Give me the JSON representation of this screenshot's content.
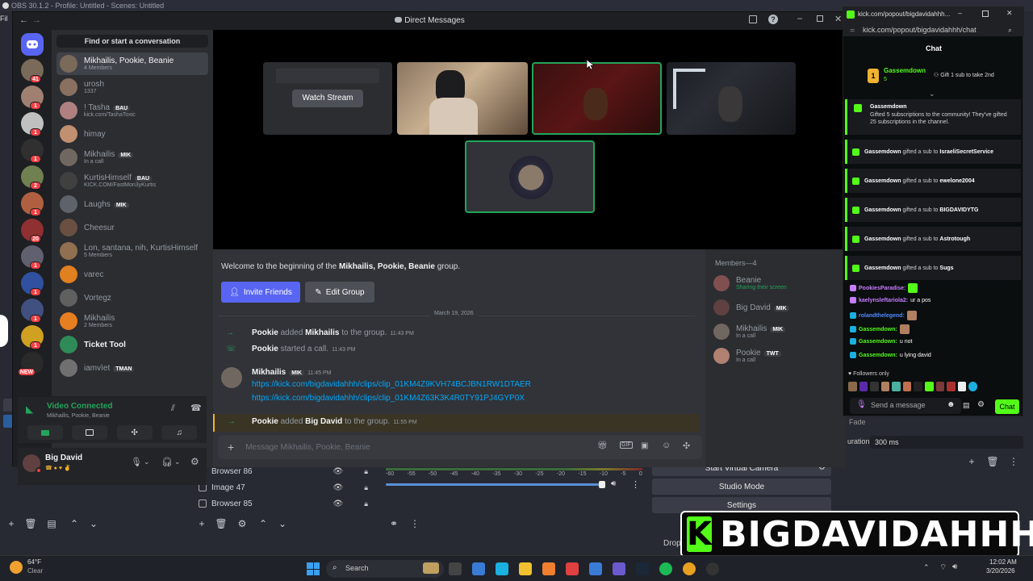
{
  "obs": {
    "window_title": "OBS 30.1.2 - Profile: Untitled - Scenes: Untitled",
    "menu_first": "Fil",
    "sources": [
      {
        "name": "Browser 86",
        "icon": "browser-icon"
      },
      {
        "name": "Image 47",
        "icon": "image-icon"
      },
      {
        "name": "Browser 85",
        "icon": "browser-icon"
      }
    ],
    "audio_ticks": [
      "-60",
      "-55",
      "-50",
      "-45",
      "-40",
      "-35",
      "-30",
      "-25",
      "-20",
      "-15",
      "-10",
      "-5",
      "0"
    ],
    "controls": [
      "Start Virtual Camera",
      "Studio Mode",
      "Settings"
    ],
    "transition_label": "Fade",
    "duration_label": "uration",
    "duration_value": "300 ms",
    "drop_label": "Drop"
  },
  "discord": {
    "window_title": "Direct Messages",
    "search_placeholder": "Find or start a conversation",
    "guild_badges": [
      "41",
      "1",
      "1",
      "1",
      "2",
      "1",
      "20",
      "1",
      "1",
      "1",
      "1",
      "NEW"
    ],
    "dms": [
      {
        "name": "Mikhailis, Pookie, Beanie",
        "sub": "4 Members",
        "tag": "",
        "color": "#7a6a5a"
      },
      {
        "name": "urosh",
        "sub": "1337",
        "tag": "",
        "color": "#8a7060"
      },
      {
        "name": "! Tasha",
        "sub": "kick.com/TashaToxic",
        "tag": "BAU",
        "color": "#b08080"
      },
      {
        "name": "himay",
        "sub": "",
        "tag": "",
        "color": "#c09070"
      },
      {
        "name": "Mikhailis",
        "sub": "In a call",
        "tag": "MIK",
        "color": "#706860"
      },
      {
        "name": "KurtisHimself",
        "sub": "KICK.COM/FastMon3yKurtis",
        "tag": "BAU",
        "color": "#404040"
      },
      {
        "name": "Laughs",
        "sub": "",
        "tag": "MIK",
        "color": "#5d626b"
      },
      {
        "name": "Cheesur",
        "sub": "",
        "tag": "",
        "color": "#6a5040"
      },
      {
        "name": "Lon, santana, nih, KurtisHimself",
        "sub": "5 Members",
        "tag": "",
        "color": "#907050"
      },
      {
        "name": "varec",
        "sub": "",
        "tag": "",
        "color": "#e08020"
      },
      {
        "name": "Vortegz",
        "sub": "",
        "tag": "",
        "color": "#606060"
      },
      {
        "name": "Mikhailis",
        "sub": "2 Members",
        "tag": "",
        "color": "#e67e22"
      },
      {
        "name": "Ticket Tool",
        "sub": "",
        "tag": "",
        "color": "#2e8b57"
      },
      {
        "name": "iamvìet",
        "sub": "",
        "tag": "TMAN",
        "color": "#707070"
      }
    ],
    "voice": {
      "status": "Video Connected",
      "channel": "Mikhailis, Pookie, Beanie"
    },
    "user": {
      "name": "Big David"
    },
    "call": {
      "watch_stream": "Watch Stream"
    },
    "welcome": {
      "prefix": "Welcome to the beginning of the ",
      "group": "Mikhailis, Pookie, Beanie",
      "suffix": " group."
    },
    "invite_button": "Invite Friends",
    "edit_button": "Edit Group",
    "date_divider": "March 19, 2026",
    "messages": [
      {
        "actor": "Pookie",
        "verb": "added",
        "target": "Mikhailis",
        "rest": "to the group.",
        "time": "11:43 PM"
      },
      {
        "actor": "Pookie",
        "verb": "started a call.",
        "target": "",
        "rest": "",
        "time": "11:43 PM"
      },
      {
        "actor": "Pookie",
        "verb": "added",
        "target": "Big David",
        "rest": "to the group.",
        "time": "11:55 PM"
      }
    ],
    "post": {
      "author": "Mikhailis",
      "tag": "MIK",
      "time": "11:45 PM",
      "links": [
        "https://kick.com/bigdavidahhh/clips/clip_01KM4Z9KVH74BCJBN1RW1DTAER",
        "https://kick.com/bigdavidahhh/clips/clip_01KM4Z63K3K4R0TY91PJ4GYP0X"
      ]
    },
    "members_header": "Members—4",
    "members": [
      {
        "name": "Beanie",
        "sub": "Sharing their screen",
        "tag": "",
        "color": "#805050"
      },
      {
        "name": "Big David",
        "sub": "",
        "tag": "MIK",
        "color": "#604040"
      },
      {
        "name": "Mikhailis",
        "sub": "In a call",
        "tag": "MIK",
        "color": "#706860"
      },
      {
        "name": "Pookie",
        "sub": "In a call",
        "tag": "TWT",
        "color": "#b08070"
      }
    ],
    "composer_placeholder": "Message Mikhailis, Pookie, Beanie"
  },
  "kick": {
    "tab_title": "kick.com/popout/bigdavidahhh...",
    "url": "kick.com/popout/bigdavidahhh/chat",
    "chat_header": "Chat",
    "pinned": {
      "user": "Gassemdown",
      "count": "5",
      "action": "Gift 1 sub to take 2nd"
    },
    "gift_main": {
      "user": "Gassemdown",
      "text": "Gifted 5 subscriptions to the community! They've gifted 25 subscriptions in the channel."
    },
    "gifts": [
      {
        "user": "Gassemdown",
        "text": "gifted a sub to",
        "target": "IsraeliSecretService"
      },
      {
        "user": "Gassemdown",
        "text": "gifted a sub to",
        "target": "ewelone2004"
      },
      {
        "user": "Gassemdown",
        "text": "gifted a sub to",
        "target": "BIGDAVIDYTG"
      },
      {
        "user": "Gassemdown",
        "text": "gifted a sub to",
        "target": "Astrotough"
      },
      {
        "user": "Gassemdown",
        "text": "gifted a sub to",
        "target": "Sugs"
      }
    ],
    "chat_lines": [
      {
        "user": "PookiesParadise:",
        "text": "",
        "color": "#c77dff"
      },
      {
        "user": "kaelynsleftariola2:",
        "text": "ur a pos",
        "color": "#c77dff"
      },
      {
        "user": "rolandthelegend:",
        "text": "",
        "color": "#4f8bff"
      },
      {
        "user": "Gassemdown:",
        "text": "",
        "color": "#53fc18"
      },
      {
        "user": "Gassemdown:",
        "text": "u not",
        "color": "#53fc18"
      },
      {
        "user": "Gassemdown:",
        "text": "u lying david",
        "color": "#53fc18"
      }
    ],
    "followers_only": "Followers only",
    "send_placeholder": "Send a message",
    "chat_button": "Chat"
  },
  "overlay": {
    "logo_letter": "K",
    "name": "BIGDAVIDAHHH"
  },
  "taskbar": {
    "temp": "64°F",
    "weather": "Clear",
    "search": "Search",
    "time": "12:02 AM",
    "date": "3/20/2026"
  },
  "colors": {
    "kick_green": "#53fc18",
    "discord_blurple": "#5865f2",
    "discord_green": "#23a559"
  }
}
